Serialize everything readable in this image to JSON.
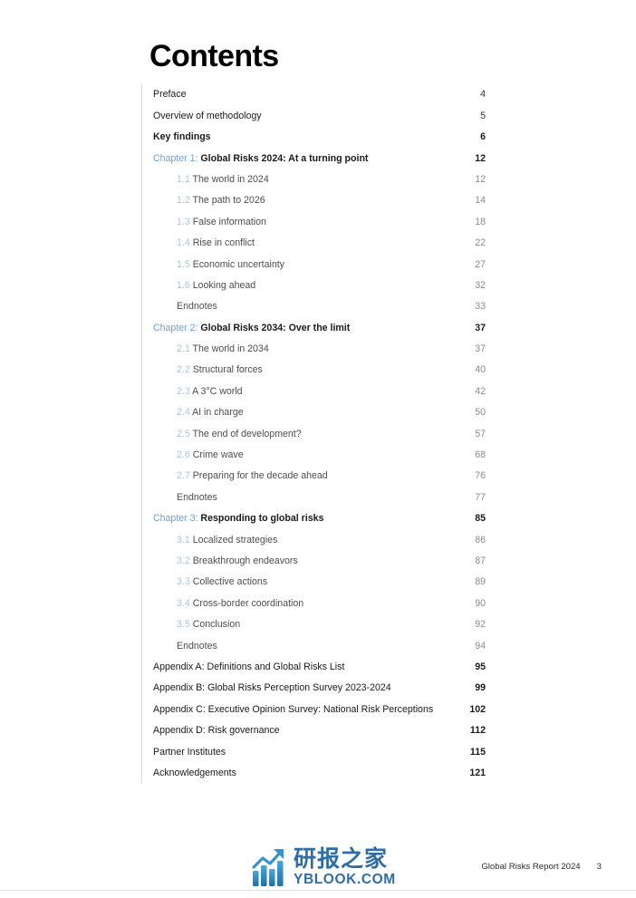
{
  "document": {
    "heading": "Contents",
    "entries": [
      {
        "level": "top-plain",
        "label": "Preface",
        "page": "4"
      },
      {
        "level": "top-plain",
        "label": "Overview of methodology",
        "page": "5"
      },
      {
        "level": "top",
        "label": "Key findings",
        "page": "6"
      },
      {
        "level": "chapter",
        "tag": "Chapter 1:",
        "label": "Global Risks 2024: At a turning point",
        "page": "12"
      },
      {
        "level": "sub",
        "num": "1.1",
        "label": "The world in 2024",
        "page": "12"
      },
      {
        "level": "sub",
        "num": "1.2",
        "label": "The path to 2026",
        "page": "14"
      },
      {
        "level": "sub",
        "num": "1.3",
        "label": "False information",
        "page": "18"
      },
      {
        "level": "sub",
        "num": "1.4",
        "label": "Rise in conflict",
        "page": "22"
      },
      {
        "level": "sub",
        "num": "1.5",
        "label": "Economic uncertainty",
        "page": "27"
      },
      {
        "level": "sub",
        "num": "1.6",
        "label": "Looking ahead",
        "page": "32"
      },
      {
        "level": "endnote",
        "label": "Endnotes",
        "page": "33"
      },
      {
        "level": "chapter",
        "tag": "Chapter 2:",
        "label": "Global Risks 2034: Over the limit",
        "page": "37"
      },
      {
        "level": "sub",
        "num": "2.1",
        "label": "The world in 2034",
        "page": "37"
      },
      {
        "level": "sub",
        "num": "2.2",
        "label": "Structural forces",
        "page": "40"
      },
      {
        "level": "sub",
        "num": "2.3",
        "label": "A 3°C world",
        "page": "42"
      },
      {
        "level": "sub",
        "num": "2.4",
        "label": "AI in charge",
        "page": "50"
      },
      {
        "level": "sub",
        "num": "2.5",
        "label": "The end of development?",
        "page": "57"
      },
      {
        "level": "sub",
        "num": "2.6",
        "label": "Crime wave",
        "page": "68"
      },
      {
        "level": "sub",
        "num": "2.7",
        "label": "Preparing for the decade ahead",
        "page": "76"
      },
      {
        "level": "endnote",
        "label": "Endnotes",
        "page": "77"
      },
      {
        "level": "chapter",
        "tag": "Chapter 3:",
        "label": "Responding to global risks",
        "page": "85"
      },
      {
        "level": "sub",
        "num": "3.1",
        "label": "Localized strategies",
        "page": "86"
      },
      {
        "level": "sub",
        "num": "3.2",
        "label": "Breakthrough endeavors",
        "page": "87"
      },
      {
        "level": "sub",
        "num": "3.3",
        "label": "Collective actions",
        "page": "89"
      },
      {
        "level": "sub",
        "num": "3.4",
        "label": "Cross-border coordination",
        "page": "90"
      },
      {
        "level": "sub",
        "num": "3.5",
        "label": "Conclusion",
        "page": "92"
      },
      {
        "level": "endnote",
        "label": "Endnotes",
        "page": "94"
      },
      {
        "level": "appendix",
        "label": "Appendix A: Definitions and Global Risks List",
        "page": "95"
      },
      {
        "level": "appendix",
        "label": "Appendix B: Global Risks Perception Survey 2023-2024",
        "page": "99"
      },
      {
        "level": "appendix",
        "label": "Appendix C: Executive Opinion Survey: National Risk Perceptions",
        "page": "102"
      },
      {
        "level": "appendix",
        "label": "Appendix D: Risk governance",
        "page": "112"
      },
      {
        "level": "appendix",
        "label": "Partner Institutes",
        "page": "115"
      },
      {
        "level": "appendix",
        "label": "Acknowledgements",
        "page": "121"
      }
    ]
  },
  "footer": {
    "report_title": "Global Risks Report 2024",
    "page_number": "3",
    "watermark": {
      "icon": "bar-chart-growth-icon",
      "cn_name": "研报之家",
      "domain": "YBLOOK.COM",
      "color": "#2f6ea5"
    }
  },
  "colors": {
    "chapter_blue": "#6e9fd6",
    "sub_number_blue": "#a8c4e4",
    "body_text": "#1a1a1a",
    "sub_text": "#4d4d4d",
    "sub_page": "#8c8c8c",
    "rule": "#d9d9d9"
  }
}
